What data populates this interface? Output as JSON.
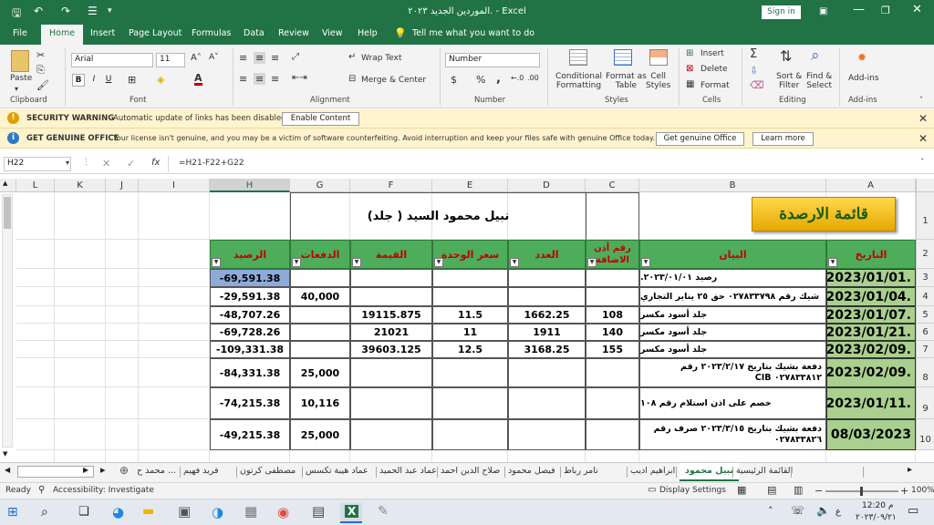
{
  "window": {
    "title": "الموردين الجديد ٢٠٢٣. - Excel",
    "signin": "Sign in"
  },
  "quick_access": {
    "save_icon": "save-icon",
    "undo_icon": "undo-icon",
    "redo_icon": "redo-icon",
    "customize_icon": "customize-icon"
  },
  "ribbon_tabs": [
    "File",
    "Home",
    "Insert",
    "Page Layout",
    "Formulas",
    "Data",
    "Review",
    "View",
    "Help"
  ],
  "tellme": "Tell me what you want to do",
  "ribbon": {
    "paste": "Paste",
    "clipboard": "Clipboard",
    "font_name": "Arial",
    "font_size": "11",
    "font": "Font",
    "bold": "B",
    "italic": "I",
    "underline": "U",
    "wrap_text": "Wrap Text",
    "merge_center": "Merge & Center",
    "alignment": "Alignment",
    "number_format": "Number",
    "number": "Number",
    "currency": "$",
    "percent": "%",
    "comma": ",",
    "cond_fmt_1": "Conditional",
    "cond_fmt_2": "Formatting",
    "fmt_table_1": "Format as",
    "fmt_table_2": "Table",
    "cell_styles_1": "Cell",
    "cell_styles_2": "Styles",
    "styles": "Styles",
    "insert": "Insert",
    "delete": "Delete",
    "format": "Format",
    "cells": "Cells",
    "sort_1": "Sort &",
    "sort_2": "Filter",
    "find_1": "Find &",
    "find_2": "Select",
    "editing": "Editing",
    "addins": "Add-ins",
    "addins_grp": "Add-ins"
  },
  "security_bar": {
    "title": "SECURITY WARNING",
    "message": "Automatic update of links has been disabled",
    "button": "Enable Content"
  },
  "genuine_bar": {
    "title": "GET GENUINE OFFICE",
    "message": "Your license isn't genuine, and you may be a victim of software counterfeiting. Avoid interruption and keep your files safe with genuine Office today.",
    "button1": "Get genuine Office",
    "button2": "Learn more"
  },
  "formula_bar": {
    "name_box": "H22",
    "fx": "fx",
    "formula": "=H21-F22+G22"
  },
  "columns": [
    "L",
    "K",
    "J",
    "I",
    "H",
    "G",
    "F",
    "E",
    "D",
    "C",
    "B",
    "A"
  ],
  "row_numbers": [
    "1",
    "2",
    "3",
    "4",
    "5",
    "6",
    "7",
    "8",
    "9",
    "10"
  ],
  "sheet": {
    "logo_text": "قائمة الارصدة",
    "client_name": "نبيل محمود السيد ( جلد)",
    "headers": {
      "date": "التاريخ",
      "statement": "البيان",
      "permit": "رقم أذن الاضافة",
      "qty": "العدد",
      "unit_price": "سعر الوحدة",
      "value": "القيمة",
      "payments": "الدفعات",
      "balance": "الرصيد"
    },
    "rows": [
      {
        "date": "2023/01/01.",
        "statement": "رصيد ٢٠٢٣/٠١/٠١.",
        "permit": "",
        "qty": "",
        "unit_price": "",
        "value": "",
        "payments": "",
        "balance": "-69,591.38"
      },
      {
        "date": "2023/01/04.",
        "statement": "شيك رقم ٠٢٧٨٣٣٧٩٨ حق ٢٥ يناير التجاري",
        "permit": "",
        "qty": "",
        "unit_price": "",
        "value": "",
        "payments": "40,000",
        "balance": "-29,591.38"
      },
      {
        "date": "2023/01/07.",
        "statement": "جلد أسود مكسر",
        "permit": "108",
        "qty": "1662.25",
        "unit_price": "11.5",
        "value": "19115.875",
        "payments": "",
        "balance": "-48,707.26"
      },
      {
        "date": "2023/01/21.",
        "statement": "جلد أسود مكسر",
        "permit": "140",
        "qty": "1911",
        "unit_price": "11",
        "value": "21021",
        "payments": "",
        "balance": "-69,728.26"
      },
      {
        "date": "2023/02/09.",
        "statement": "جلد أسود مكسر",
        "permit": "155",
        "qty": "3168.25",
        "unit_price": "12.5",
        "value": "39603.125",
        "payments": "",
        "balance": "-109,331.38"
      },
      {
        "date": "2023/02/09.",
        "statement": "دفعة بشيك بتاريخ ٢٠٢٣/٢/١٧ رقم ٠٢٧٨٣٣٨١٢ CIB",
        "permit": "",
        "qty": "",
        "unit_price": "",
        "value": "",
        "payments": "25,000",
        "balance": "-84,331.38"
      },
      {
        "date": "2023/01/11.",
        "statement": "خصم على اذن استلام رقم ١٠٨",
        "permit": "",
        "qty": "",
        "unit_price": "",
        "value": "",
        "payments": "10,116",
        "balance": "-74,215.38"
      },
      {
        "date": "08/03/2023",
        "statement": "دفعة بشيك بتاريخ ٢٠٢٣/٣/١٥ صرف رقم ٠٢٧٨٣٣٨٢٦",
        "permit": "",
        "qty": "",
        "unit_price": "",
        "value": "",
        "payments": "25,000",
        "balance": "-49,215.38"
      }
    ]
  },
  "sheet_tabs": [
    "محمد ح ...",
    "فريد فهيم",
    "مصطفى كرتون",
    "عماد هيبة تكسس",
    "عماد عبد الحميد",
    "صلاح الدين احمد",
    "فيصل محمود",
    "تامر رباط",
    "ابراهيم اديب",
    "نبيل محمود",
    "القائمة الرئيسية"
  ],
  "active_tab": "نبيل محمود",
  "status": {
    "ready": "Ready",
    "accessibility": "Accessibility: Investigate",
    "display": "Display Settings",
    "zoom": "100%"
  },
  "taskbar": {
    "time": "12:20 م",
    "date": "٢٠٢٣/٠٩/٢١",
    "lang": "ع"
  }
}
